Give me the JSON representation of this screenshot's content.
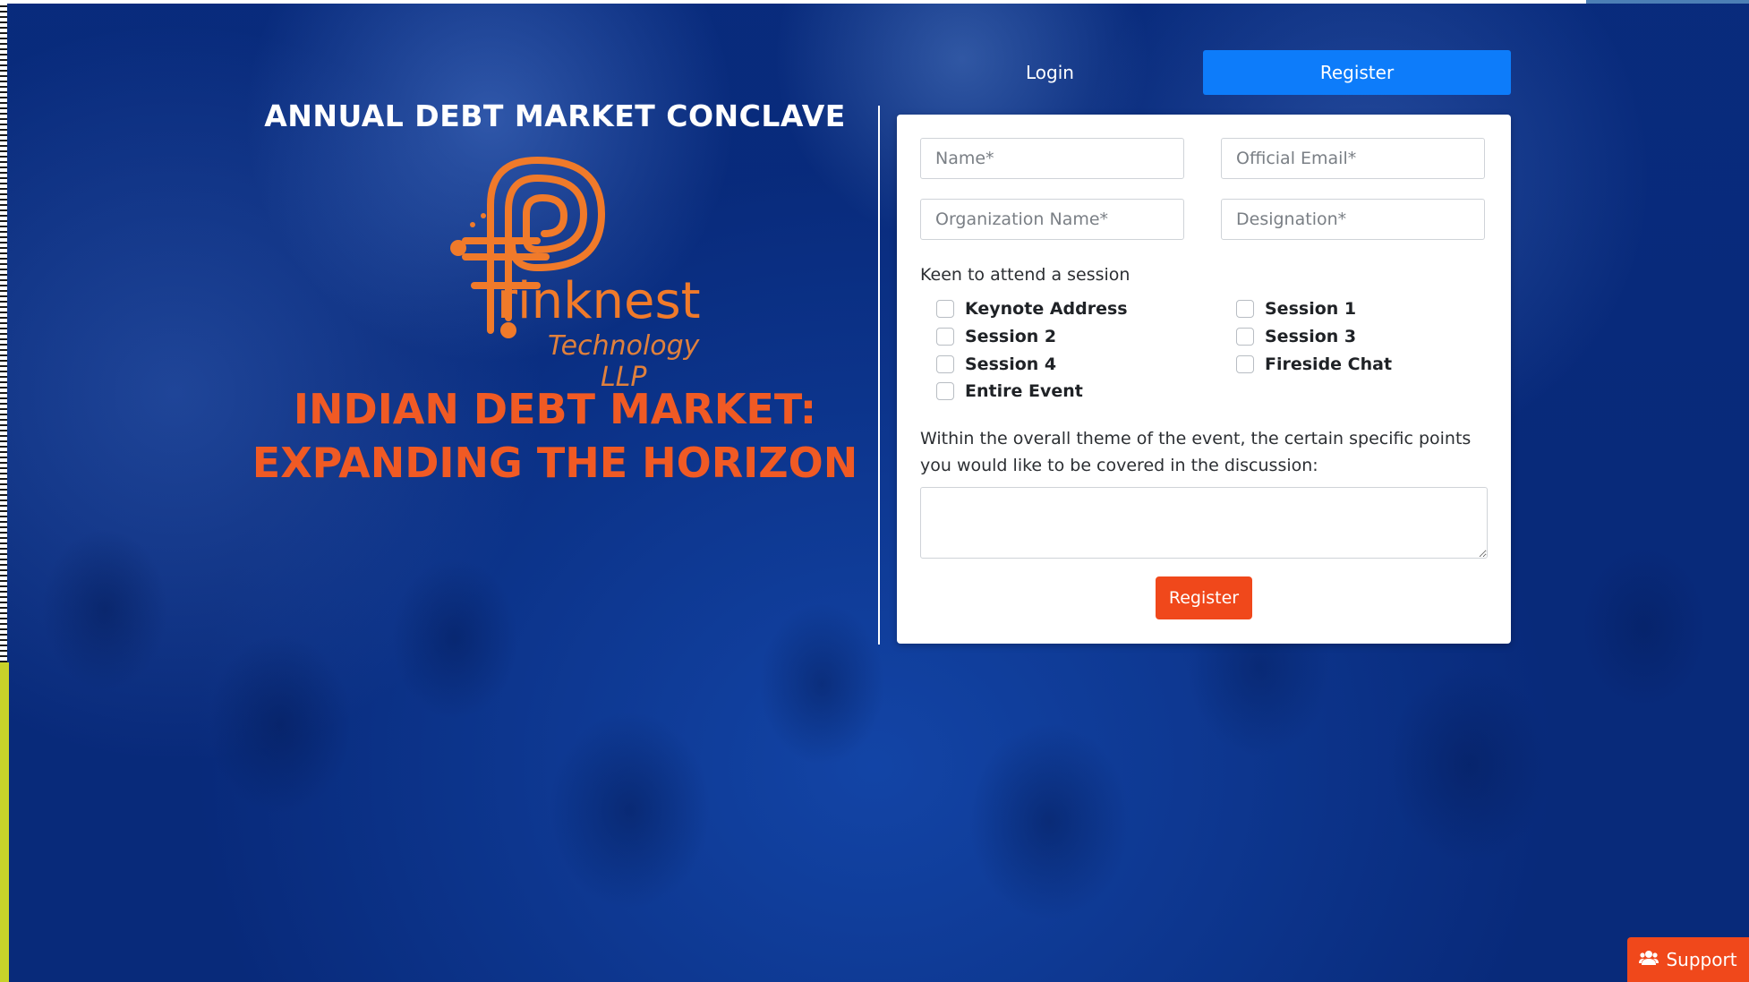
{
  "event": {
    "conclave_title": "ANNUAL DEBT MARKET CONCLAVE",
    "logo": {
      "name": "rinknest",
      "subtitle": "Technology LLP",
      "color": "#f07a2a"
    },
    "headline_line1": "INDIAN DEBT MARKET:",
    "headline_line2": "EXPANDING THE HORIZON"
  },
  "tabs": {
    "login": "Login",
    "register": "Register"
  },
  "form": {
    "name_placeholder": "Name*",
    "email_placeholder": "Official Email*",
    "org_placeholder": "Organization Name*",
    "designation_placeholder": "Designation*",
    "session_label": "Keen to attend a session",
    "sessions": [
      "Keynote Address",
      "Session 2",
      "Session 4",
      "Entire Event",
      "Session 1",
      "Session 3",
      "Fireside Chat"
    ],
    "discussion_label": "Within the overall theme of the event, the certain specific points you would like to be covered in the discussion:",
    "discussion_value": "",
    "submit_label": "Register"
  },
  "support": {
    "label": "Support",
    "icon": "users-icon"
  },
  "colors": {
    "accent_blue": "#0d7cfa",
    "accent_orange": "#f0481b",
    "background": "#0a3a8a"
  }
}
